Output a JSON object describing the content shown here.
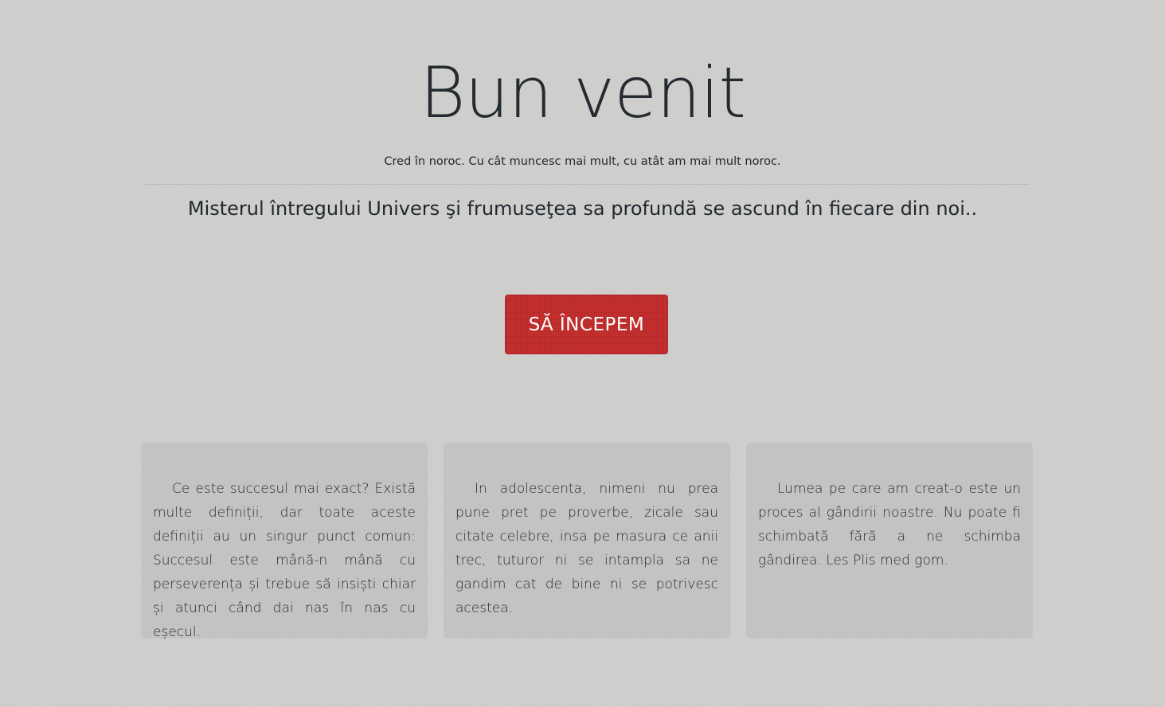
{
  "hero": {
    "title": "Bun venit",
    "quote": "Cred în noroc. Cu cât muncesc mai mult, cu atât am mai mult noroc.",
    "lead": "Misterul întregului Univers şi frumuseţea sa profundă se ascund în fiecare din noi..",
    "button_label": "SĂ ÎNCEPEM"
  },
  "cards": [
    {
      "text": "Ce este succesul mai exact? Există multe definiții, dar toate aceste definiții au un singur punct comun: Succesul este mână-n mână cu perseverența și trebue să insiști chiar și atunci când dai nas în nas cu eșecul."
    },
    {
      "text": "In adolescenta, nimeni nu prea pune pret pe proverbe, zicale sau citate celebre, insa pe masura ce anii trec, tuturor ni se intampla sa ne gandim cat de bine ni se potrivesc acestea."
    },
    {
      "text": "Lumea pe care am creat-o este un proces al gândirii noastre. Nu poate fi schimbată fără a ne schimba gândirea. Les Plis med gom."
    }
  ],
  "colors": {
    "background": "#cfcfcd",
    "button": "#c9302f",
    "card": "#c4c3c1",
    "text": "#222a31"
  }
}
